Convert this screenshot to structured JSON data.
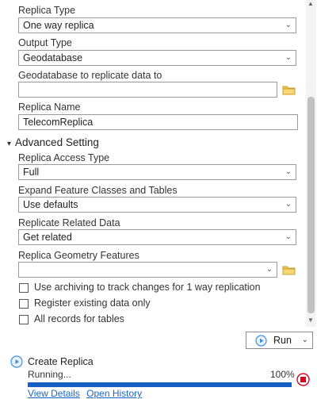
{
  "fields": {
    "replica_type": {
      "label": "Replica Type",
      "value": "One way replica"
    },
    "output_type": {
      "label": "Output Type",
      "value": "Geodatabase"
    },
    "gdb": {
      "label": "Geodatabase to replicate data to",
      "value": ""
    },
    "replica_name": {
      "label": "Replica Name",
      "value": "TelecomReplica"
    }
  },
  "advanced": {
    "title": "Advanced Setting",
    "access_type": {
      "label": "Replica Access Type",
      "value": "Full"
    },
    "expand": {
      "label": "Expand Feature Classes and Tables",
      "value": "Use defaults"
    },
    "related": {
      "label": "Replicate Related Data",
      "value": "Get related"
    },
    "geometry": {
      "label": "Replica Geometry Features",
      "value": ""
    },
    "checkboxes": [
      {
        "label": "Use archiving to track changes for 1 way replication",
        "checked": false
      },
      {
        "label": "Register existing data only",
        "checked": false
      },
      {
        "label": "All records for tables",
        "checked": false
      }
    ]
  },
  "run_button": {
    "label": "Run"
  },
  "history": {
    "title": "Create Replica",
    "status": "Running...",
    "percent_label": "100%",
    "progress": 1.0,
    "link_details": "View Details",
    "link_history": "Open History"
  },
  "colors": {
    "accent": "#1660c4",
    "stop": "#e0001b",
    "play": "#3b8fd9"
  }
}
